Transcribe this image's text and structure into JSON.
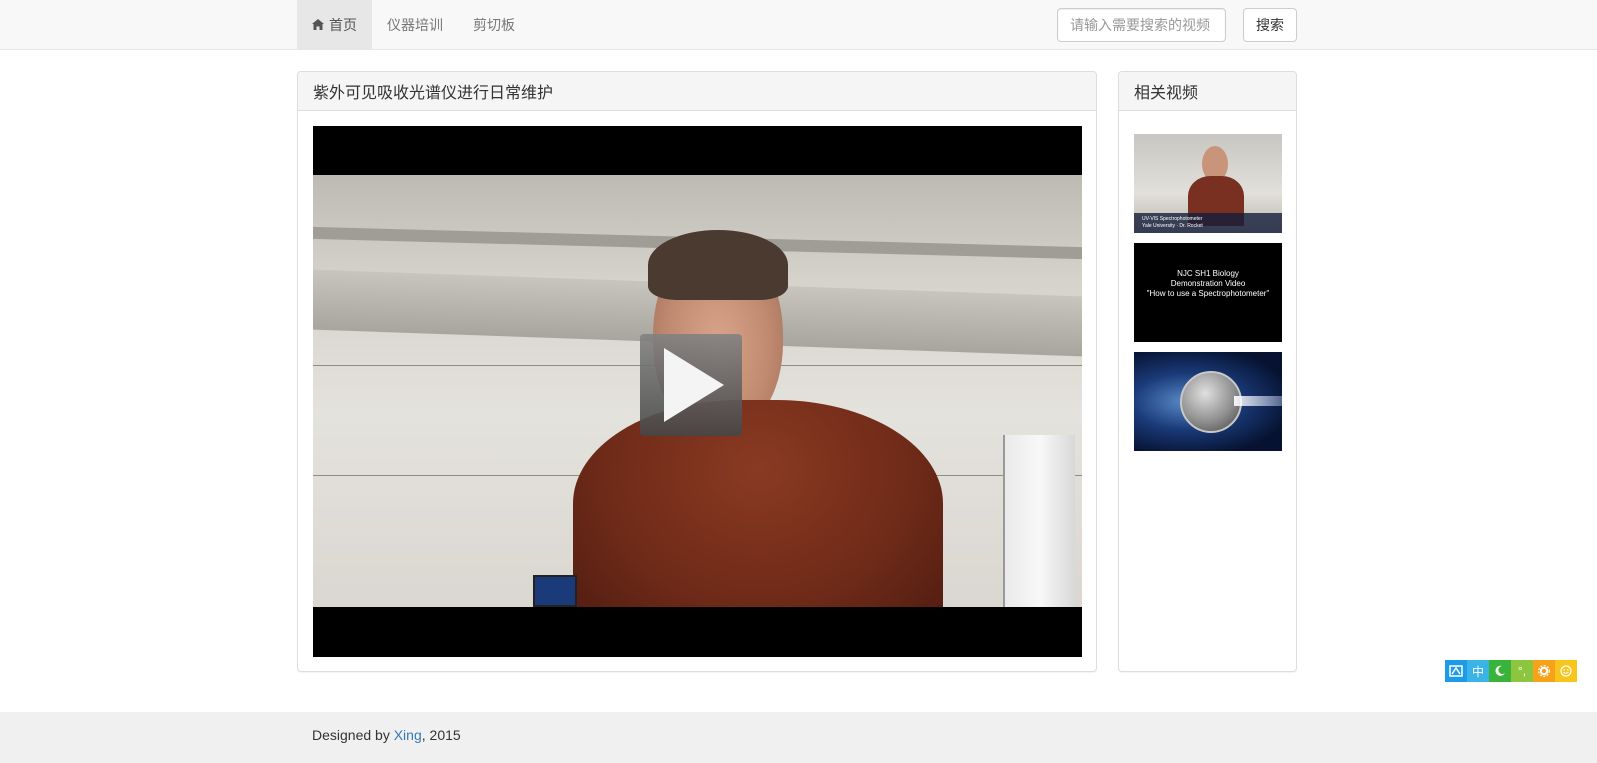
{
  "navbar": {
    "items": [
      {
        "label": "首页",
        "active": true,
        "icon": "home-icon"
      },
      {
        "label": "仪器培训",
        "active": false
      },
      {
        "label": "剪切板",
        "active": false
      }
    ],
    "search_placeholder": "请输入需要搜索的视频",
    "search_button": "搜索"
  },
  "main": {
    "title": "紫外可见吸收光谱仪进行日常维护",
    "video": {
      "play_icon": "play-icon"
    }
  },
  "sidebar": {
    "title": "相关视频",
    "thumbnails": [
      {
        "caption_line1": "UV-VIS Spectrophotometer",
        "caption_line2": "Yale University · Dr. Rocket"
      },
      {
        "line1": "NJC SH1 Biology",
        "line2": "Demonstration Video",
        "line3": "\"How to use a  Spectrophotometer\""
      },
      {
        "image": "spectrometer-sphere"
      }
    ]
  },
  "footer": {
    "prefix": "Designed by ",
    "author": "Xing",
    "suffix": ", 2015"
  },
  "ime_toolbar": {
    "buttons": [
      {
        "icon": "ime-logo-icon",
        "label": "",
        "color": "#1e9be8"
      },
      {
        "icon": "chinese-mode-icon",
        "label": "中",
        "color": "#3ab3e6"
      },
      {
        "icon": "moon-icon",
        "label": "",
        "color": "#3ab33a"
      },
      {
        "icon": "punctuation-icon",
        "label": "°,",
        "color": "#8cc63e"
      },
      {
        "icon": "settings-icon",
        "label": "",
        "color": "#f7a21b"
      },
      {
        "icon": "smiley-icon",
        "label": "",
        "color": "#f7c51b"
      }
    ]
  },
  "colors": {
    "link": "#337ab7",
    "nav_active_bg": "#e7e7e7",
    "panel_heading_bg": "#f5f5f5"
  }
}
